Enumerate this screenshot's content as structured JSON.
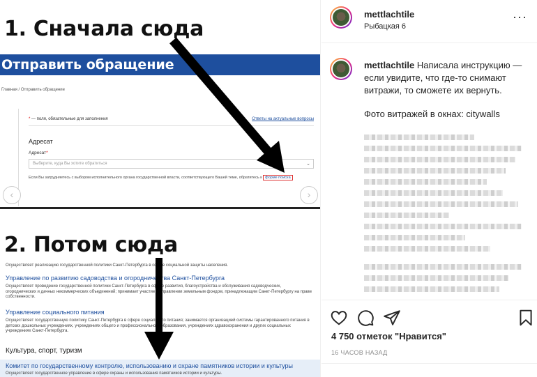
{
  "post_image": {
    "step1_title": "1. Сначала сюда",
    "step2_title": "2. Потом сюда",
    "shot1": {
      "banner": "Отправить обращение",
      "breadcrumbs": "Главная   /   Отправить обращение",
      "required_note_star": "*",
      "required_note": " — поля, обязательные для заполнения",
      "faq_link": "Ответы на актуальные вопросы",
      "section_title": "Адресат",
      "field_label": "Адресат",
      "field_star": "*",
      "select_placeholder": "Выберите, куда Вы хотите обратиться",
      "hint_text": "Если Вы затрудняетесь с выбором исполнительного органа государственной власти, соответствующего Вашей теме, обратитесь к",
      "hint_link": "форме поиска"
    },
    "shot2": {
      "line0": "Осуществляет реализацию государственной политики Санкт-Петербурга в сфере социальной защиты населения.",
      "h1": "Управление по развитию садоводства и огородничества Санкт-Петербурга",
      "d1": "Осуществляет проведение государственной политики Санкт-Петербурга в сфере развития, благоустройства и обслуживания садоводческих, огороднических и дачных некоммерческих объединений; принимает участие в управлении земельным фондом, принадлежащим Санкт-Петербургу на праве собственности.",
      "h2": "Управление социального питания",
      "d2": "Осуществляет государственную политику Санкт-Петербурга в сфере социального питания; занимается организацией системы гарантированного питания в детских дошкольных учреждениях, учреждениях общего и профессионального образования, учреждениях здравоохранения и других социальных учреждениях Санкт-Петербурга.",
      "category": "Культура, спорт, туризм",
      "h3": "Комитет по государственному контролю, использованию и охране памятников истории и культуры",
      "d3": "Осуществляет государственное управление в сфере охраны и использования памятников истории и культуры."
    }
  },
  "header": {
    "username": "mettlachtile",
    "location": "Рыбацкая 6",
    "more_label": "···"
  },
  "caption": {
    "username": "mettlachtile",
    "text": "Написала инструкцию — если увидите, что где-то снимают витражи, то сможете их вернуть.",
    "photo_credit": "Фото витражей в окнах: citywalls"
  },
  "actions": {
    "likes": "4 750 отметок \"Нравится\"",
    "time": "16 ЧАСОВ НАЗАД"
  }
}
